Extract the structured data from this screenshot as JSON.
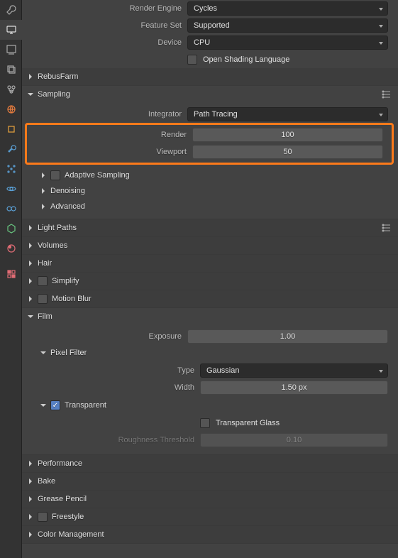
{
  "tabs": [
    "tool",
    "output",
    "view",
    "render",
    "layers",
    "scene",
    "world",
    "object",
    "modifier",
    "particle",
    "physics",
    "constraint",
    "material",
    "texture",
    "misc"
  ],
  "fields": {
    "render_engine": {
      "label": "Render Engine",
      "value": "Cycles"
    },
    "feature_set": {
      "label": "Feature Set",
      "value": "Supported"
    },
    "device": {
      "label": "Device",
      "value": "CPU"
    },
    "osl": {
      "label": "Open Shading Language"
    },
    "integrator": {
      "label": "Integrator",
      "value": "Path Tracing"
    },
    "render_samples": {
      "label": "Render",
      "value": "100"
    },
    "viewport_samples": {
      "label": "Viewport",
      "value": "50"
    },
    "exposure": {
      "label": "Exposure",
      "value": "1.00"
    },
    "filter_type": {
      "label": "Type",
      "value": "Gaussian"
    },
    "filter_width": {
      "label": "Width",
      "value": "1.50 px"
    },
    "transparent_glass": {
      "label": "Transparent Glass"
    },
    "roughness_threshold": {
      "label": "Roughness Threshold",
      "value": "0.10"
    }
  },
  "panels": {
    "rebusfarm": "RebusFarm",
    "sampling": "Sampling",
    "adaptive_sampling": "Adaptive Sampling",
    "denoising": "Denoising",
    "advanced": "Advanced",
    "light_paths": "Light Paths",
    "volumes": "Volumes",
    "hair": "Hair",
    "simplify": "Simplify",
    "motion_blur": "Motion Blur",
    "film": "Film",
    "pixel_filter": "Pixel Filter",
    "transparent": "Transparent",
    "performance": "Performance",
    "bake": "Bake",
    "grease_pencil": "Grease Pencil",
    "freestyle": "Freestyle",
    "color_management": "Color Management"
  }
}
